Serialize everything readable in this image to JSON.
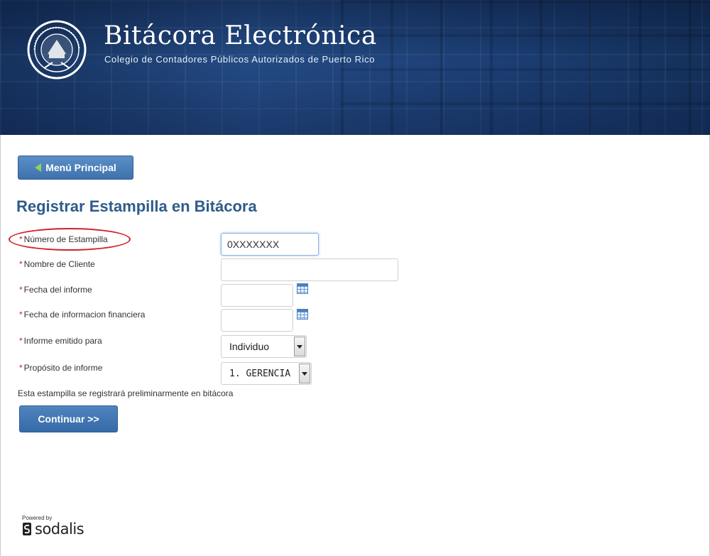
{
  "header": {
    "title": "Bitácora Electrónica",
    "subtitle": "Colegio de Contadores Públicos Autorizados de Puerto Rico"
  },
  "nav": {
    "menu_button": "Menú Principal"
  },
  "page": {
    "title": "Registrar Estampilla en Bitácora"
  },
  "form": {
    "required_mark": "*",
    "fields": [
      {
        "label": "Número de Estampilla",
        "value": "0XXXXXXX"
      },
      {
        "label": "Nombre de Cliente",
        "value": ""
      },
      {
        "label": "Fecha del informe",
        "value": ""
      },
      {
        "label": "Fecha de informacion financiera",
        "value": ""
      },
      {
        "label": "Informe emitido para",
        "value": "Individuo"
      },
      {
        "label": "Propósito de informe",
        "value": "1. GERENCIA"
      }
    ],
    "note": "Esta estampilla se registrará preliminarmente en bitácora",
    "continue_button": "Continuar >>"
  },
  "footer": {
    "powered_by": "Powered by",
    "brand": "sodalis"
  },
  "colors": {
    "accent": "#3f72ad",
    "title": "#2f5b8a",
    "required": "#c0262d",
    "highlight": "#d21f2b"
  }
}
